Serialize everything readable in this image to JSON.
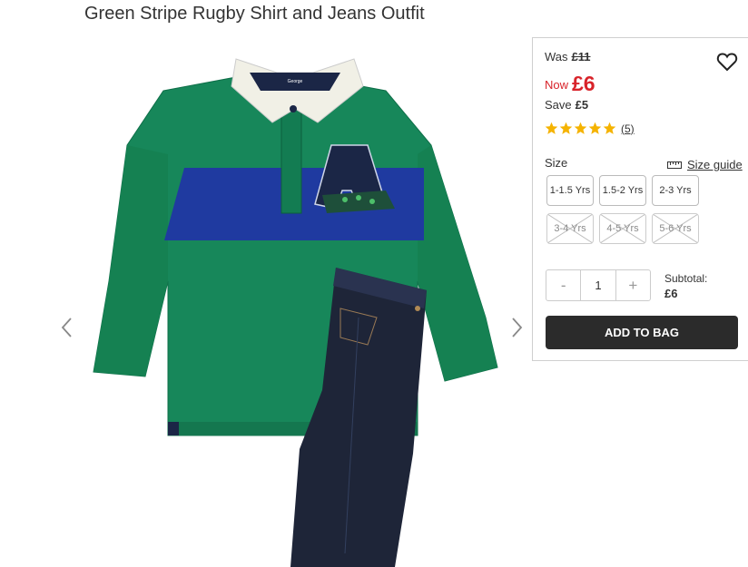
{
  "product": {
    "title": "Green Stripe Rugby Shirt and Jeans Outfit",
    "image_alt": "Green Stripe Rugby Shirt and Jeans Outfit product photo",
    "shirt_label": "George"
  },
  "pricing": {
    "was_label": "Was",
    "was_price": "£11",
    "now_label": "Now",
    "now_price": "£6",
    "save_label": "Save",
    "save_amount": "£5",
    "accent_color": "#d8232a"
  },
  "rating": {
    "stars": 5,
    "review_count": "(5)",
    "star_color": "#f5b301"
  },
  "size": {
    "label": "Size",
    "guide_label": "Size guide",
    "options": [
      {
        "label": "1-1.5 Yrs",
        "available": true
      },
      {
        "label": "1.5-2 Yrs",
        "available": true
      },
      {
        "label": "2-3 Yrs",
        "available": true
      },
      {
        "label": "3-4 Yrs",
        "available": false
      },
      {
        "label": "4-5 Yrs",
        "available": false
      },
      {
        "label": "5-6 Yrs",
        "available": false
      }
    ]
  },
  "quantity": {
    "minus": "-",
    "value": "1",
    "plus": "+"
  },
  "subtotal": {
    "label": "Subtotal:",
    "value": "£6"
  },
  "cart": {
    "add_label": "ADD TO BAG"
  },
  "icons": {
    "prev": "chevron-left-icon",
    "next": "chevron-right-icon",
    "wishlist": "heart-icon",
    "size_guide": "ruler-icon",
    "star": "star-icon"
  }
}
